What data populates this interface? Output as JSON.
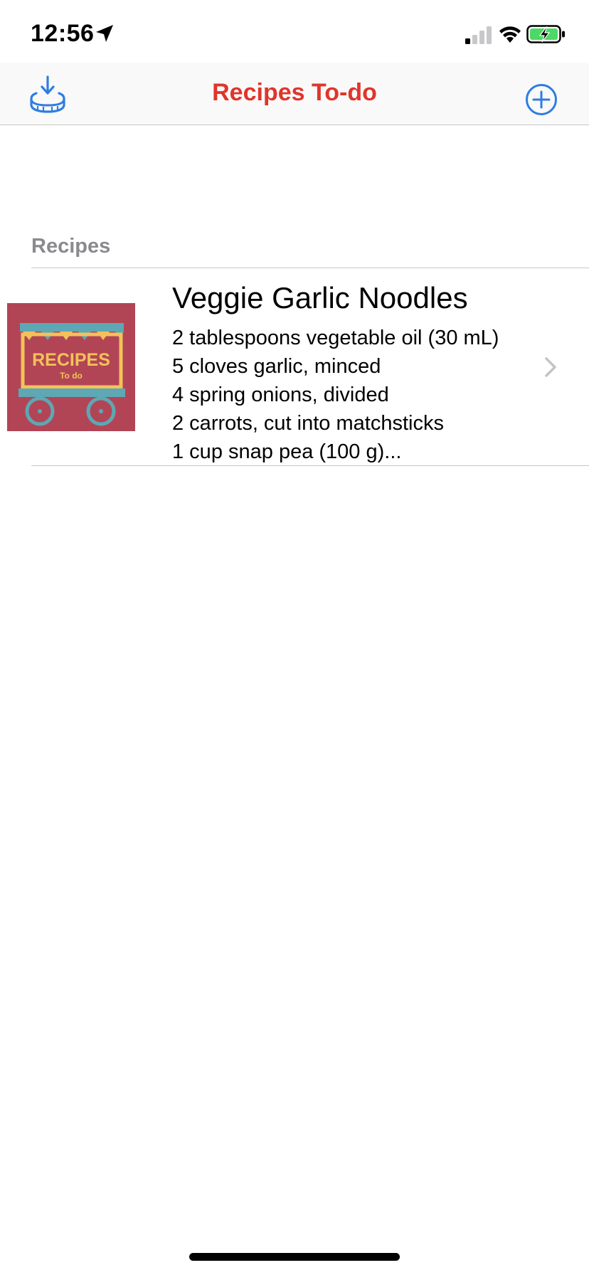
{
  "status_bar": {
    "time": "12:56",
    "icons": [
      "location-arrow-icon",
      "cellular-signal-icon",
      "wifi-icon",
      "battery-charging-icon"
    ]
  },
  "nav": {
    "title": "Recipes To-do",
    "left_button_icon": "download-tray-icon",
    "right_button_icon": "add-circle-icon",
    "title_color": "#e0352b",
    "accent_color": "#2f7de1"
  },
  "section": {
    "header": "Recipes"
  },
  "recipes": [
    {
      "title": "Veggie Garlic Noodles",
      "thumbnail": {
        "logo_text": "RECIPES",
        "logo_subtext": "To do",
        "icon": "recipes-cart-thumbnail",
        "background_color": "#b24555"
      },
      "lines": [
        "2 tablespoons  vegetable oil (30 mL)",
        "5 cloves garlic, minced",
        "4 spring onions, divided",
        "2 carrots, cut into matchsticks",
        "1 cup  snap pea (100 g)..."
      ]
    }
  ]
}
